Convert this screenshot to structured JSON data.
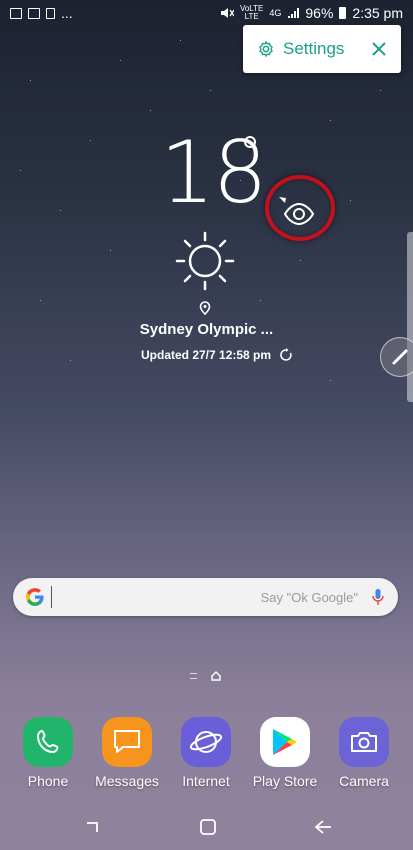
{
  "status_bar": {
    "network_top": "VoLTE",
    "network_bottom": "LTE",
    "network_type": "4G",
    "battery": "96%",
    "time": "2:35 pm",
    "more": "..."
  },
  "settings_popup": {
    "label": "Settings",
    "accent_color": "#1aa08a"
  },
  "weather": {
    "temperature": "18",
    "condition_icon": "sun-icon",
    "location": "Sydney Olympic ...",
    "updated": "Updated 27/7 12:58 pm"
  },
  "search_bar": {
    "hint": "Say \"Ok Google\""
  },
  "dock": [
    {
      "label": "Phone",
      "icon": "phone-icon",
      "color": "#20b56a"
    },
    {
      "label": "Messages",
      "icon": "messages-icon",
      "color": "#f7941d"
    },
    {
      "label": "Internet",
      "icon": "internet-icon",
      "color": "#6a5fd8"
    },
    {
      "label": "Play Store",
      "icon": "play-store-icon",
      "color": "#ffffff"
    },
    {
      "label": "Camera",
      "icon": "camera-icon",
      "color": "#6b63d6"
    }
  ],
  "nav": [
    "recents-icon",
    "home-icon",
    "back-icon"
  ]
}
